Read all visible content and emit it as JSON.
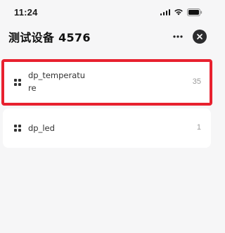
{
  "status_bar": {
    "time": "11:24"
  },
  "header": {
    "title": "测试设备 4576"
  },
  "datapoints": [
    {
      "name_line1": "dp_temperatu",
      "name_line2": "re",
      "value": "35",
      "highlighted": true
    },
    {
      "name_line1": "dp_led",
      "value": "1",
      "highlighted": false
    }
  ],
  "colors": {
    "highlight": "#e8212f",
    "background": "#f6f6f7",
    "card": "#ffffff"
  },
  "icons": [
    "signal-icon",
    "wifi-icon",
    "battery-icon",
    "more-icon",
    "close-icon",
    "grid-icon"
  ]
}
